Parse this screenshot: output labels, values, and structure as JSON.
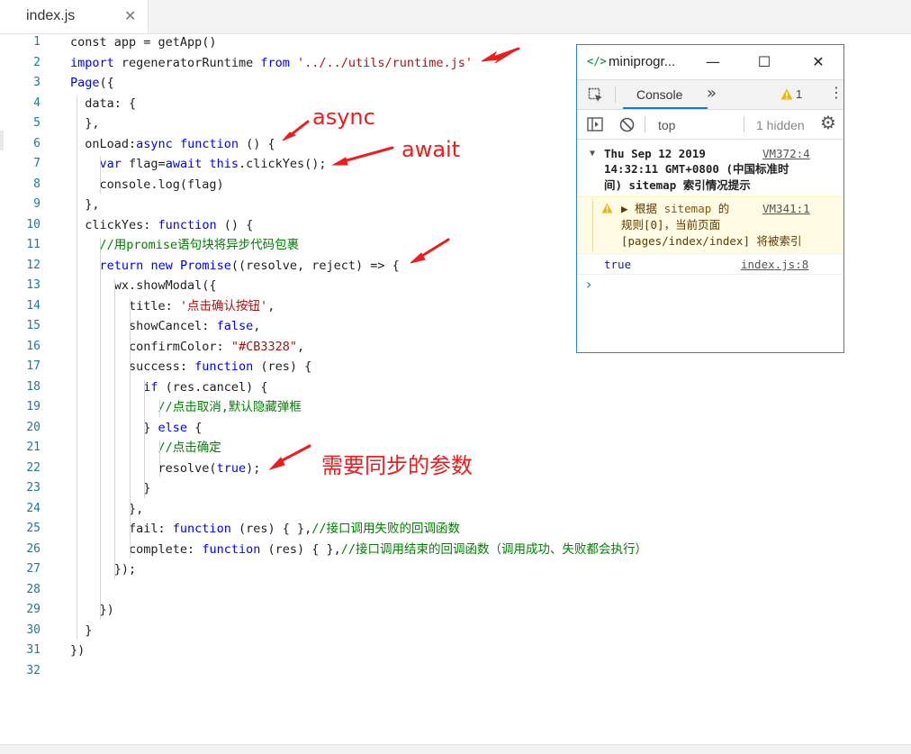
{
  "tab": {
    "filename": "index.js",
    "close_glyph": "✕"
  },
  "code_lines": [
    {
      "n": "1",
      "tokens": [
        {
          "t": "const app = getApp()",
          "c": ""
        }
      ]
    },
    {
      "n": "2",
      "tokens": [
        {
          "t": "import",
          "c": "kw"
        },
        {
          "t": " regeneratorRuntime ",
          "c": ""
        },
        {
          "t": "from",
          "c": "kw"
        },
        {
          "t": " ",
          "c": ""
        },
        {
          "t": "'../../utils/runtime.js'",
          "c": "str"
        }
      ]
    },
    {
      "n": "3",
      "tokens": [
        {
          "t": "Page",
          "c": "kw"
        },
        {
          "t": "({",
          "c": ""
        }
      ]
    },
    {
      "n": "4",
      "tokens": [
        {
          "t": "  data: {",
          "c": ""
        }
      ]
    },
    {
      "n": "5",
      "tokens": [
        {
          "t": "  },",
          "c": ""
        }
      ]
    },
    {
      "n": "6",
      "tokens": [
        {
          "t": "  onLoad:",
          "c": ""
        },
        {
          "t": "async",
          "c": "kw"
        },
        {
          "t": " ",
          "c": ""
        },
        {
          "t": "function",
          "c": "kw"
        },
        {
          "t": " () {",
          "c": ""
        }
      ]
    },
    {
      "n": "7",
      "tokens": [
        {
          "t": "    ",
          "c": ""
        },
        {
          "t": "var",
          "c": "kw"
        },
        {
          "t": " flag=",
          "c": ""
        },
        {
          "t": "await",
          "c": "kw"
        },
        {
          "t": " ",
          "c": ""
        },
        {
          "t": "this",
          "c": "kw"
        },
        {
          "t": ".clickYes();",
          "c": ""
        }
      ]
    },
    {
      "n": "8",
      "tokens": [
        {
          "t": "    console.log(flag)",
          "c": ""
        }
      ]
    },
    {
      "n": "9",
      "tokens": [
        {
          "t": "  },",
          "c": ""
        }
      ]
    },
    {
      "n": "10",
      "tokens": [
        {
          "t": "  clickYes: ",
          "c": ""
        },
        {
          "t": "function",
          "c": "kw"
        },
        {
          "t": " () {",
          "c": ""
        }
      ]
    },
    {
      "n": "11",
      "tokens": [
        {
          "t": "    ",
          "c": ""
        },
        {
          "t": "//用promise语句块将异步代码包裹",
          "c": "cmt"
        }
      ]
    },
    {
      "n": "12",
      "tokens": [
        {
          "t": "    ",
          "c": ""
        },
        {
          "t": "return",
          "c": "kw"
        },
        {
          "t": " ",
          "c": ""
        },
        {
          "t": "new",
          "c": "kw"
        },
        {
          "t": " ",
          "c": ""
        },
        {
          "t": "Promise",
          "c": "kw"
        },
        {
          "t": "((resolve, reject) => {",
          "c": ""
        }
      ]
    },
    {
      "n": "13",
      "tokens": [
        {
          "t": "      wx.showModal({",
          "c": ""
        }
      ]
    },
    {
      "n": "14",
      "tokens": [
        {
          "t": "        title: ",
          "c": ""
        },
        {
          "t": "'点击确认按钮'",
          "c": "str"
        },
        {
          "t": ",",
          "c": ""
        }
      ]
    },
    {
      "n": "15",
      "tokens": [
        {
          "t": "        showCancel: ",
          "c": ""
        },
        {
          "t": "false",
          "c": "kw"
        },
        {
          "t": ",",
          "c": ""
        }
      ]
    },
    {
      "n": "16",
      "tokens": [
        {
          "t": "        confirmColor: ",
          "c": ""
        },
        {
          "t": "\"#CB3328\"",
          "c": "str"
        },
        {
          "t": ",",
          "c": ""
        }
      ]
    },
    {
      "n": "17",
      "tokens": [
        {
          "t": "        success: ",
          "c": ""
        },
        {
          "t": "function",
          "c": "kw"
        },
        {
          "t": " (res) {",
          "c": ""
        }
      ]
    },
    {
      "n": "18",
      "tokens": [
        {
          "t": "          ",
          "c": ""
        },
        {
          "t": "if",
          "c": "kw"
        },
        {
          "t": " (res.cancel) {",
          "c": ""
        }
      ]
    },
    {
      "n": "19",
      "tokens": [
        {
          "t": "            ",
          "c": ""
        },
        {
          "t": "//点击取消,默认隐藏弹框",
          "c": "cmt"
        }
      ]
    },
    {
      "n": "20",
      "tokens": [
        {
          "t": "          } ",
          "c": ""
        },
        {
          "t": "else",
          "c": "kw"
        },
        {
          "t": " {",
          "c": ""
        }
      ]
    },
    {
      "n": "21",
      "tokens": [
        {
          "t": "            ",
          "c": ""
        },
        {
          "t": "//点击确定",
          "c": "cmt"
        }
      ]
    },
    {
      "n": "22",
      "tokens": [
        {
          "t": "            resolve(",
          "c": ""
        },
        {
          "t": "true",
          "c": "kw"
        },
        {
          "t": ");",
          "c": ""
        }
      ]
    },
    {
      "n": "23",
      "tokens": [
        {
          "t": "          }",
          "c": ""
        }
      ]
    },
    {
      "n": "24",
      "tokens": [
        {
          "t": "        },",
          "c": ""
        }
      ]
    },
    {
      "n": "25",
      "tokens": [
        {
          "t": "        fail: ",
          "c": ""
        },
        {
          "t": "function",
          "c": "kw"
        },
        {
          "t": " (res) { },",
          "c": ""
        },
        {
          "t": "//接口调用失败的回调函数",
          "c": "cmt"
        }
      ]
    },
    {
      "n": "26",
      "tokens": [
        {
          "t": "        complete: ",
          "c": ""
        },
        {
          "t": "function",
          "c": "kw"
        },
        {
          "t": " (res) { },",
          "c": ""
        },
        {
          "t": "//接口调用结束的回调函数（调用成功、失败都会执行）",
          "c": "cmt"
        }
      ]
    },
    {
      "n": "27",
      "tokens": [
        {
          "t": "      });",
          "c": ""
        }
      ]
    },
    {
      "n": "28",
      "tokens": [
        {
          "t": "",
          "c": ""
        }
      ]
    },
    {
      "n": "29",
      "tokens": [
        {
          "t": "    })",
          "c": ""
        }
      ]
    },
    {
      "n": "30",
      "tokens": [
        {
          "t": "  }",
          "c": ""
        }
      ]
    },
    {
      "n": "31",
      "tokens": [
        {
          "t": "})",
          "c": ""
        }
      ]
    },
    {
      "n": "32",
      "tokens": [
        {
          "t": "",
          "c": ""
        }
      ]
    }
  ],
  "annotations": {
    "async": "async",
    "await": "await",
    "sync_param": "需要同步的参数"
  },
  "devtools": {
    "title": "miniprogr...",
    "icon_code": "</>",
    "minimize": "—",
    "maximize": "☐",
    "close": "✕",
    "tab_console": "Console",
    "more_tabs": "»",
    "warn_count": "1",
    "context": "top",
    "hidden": "1 hidden",
    "messages": {
      "log1_line1": "Thu Sep 12 2019",
      "log1_line2": "14:32:11 GMT+0800 (中国标准时",
      "log1_line3": "间) sitemap 索引情况提示",
      "log1_link": "VM372:4",
      "warn_line1_pre": "▶ 根据 ",
      "warn_line1_code": "sitemap",
      "warn_line1_post": " 的",
      "warn_line2": "规则[0]，当前页面",
      "warn_line3": "[pages/index/index] 将被索引",
      "warn_link": "VM341:1",
      "value": "true",
      "value_link": "index.js:8",
      "prompt": "›"
    }
  },
  "colors": {
    "keyword": "#0000ff",
    "string": "#a31515",
    "comment": "#008000",
    "line_number": "#237893",
    "annotation": "#ee1c1c",
    "devtools_border": "#2b83d6"
  }
}
